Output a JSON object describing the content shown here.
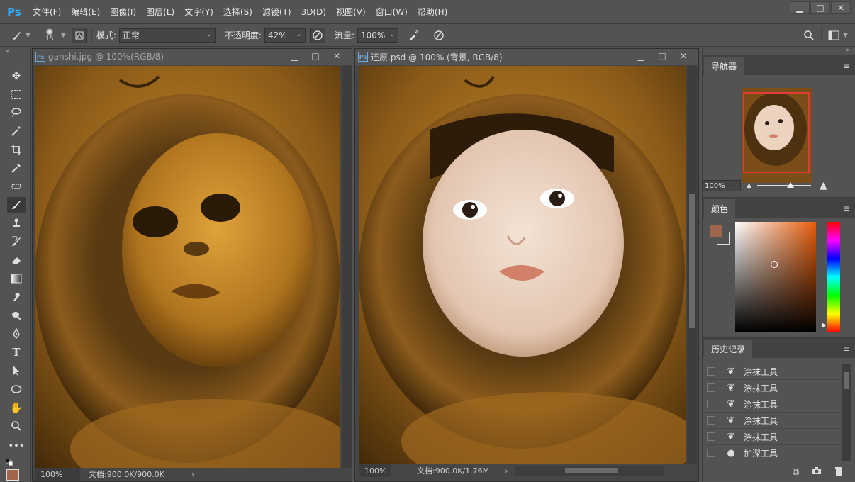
{
  "app": {
    "logo": "Ps"
  },
  "menu": [
    "文件(F)",
    "编辑(E)",
    "图像(I)",
    "图层(L)",
    "文字(Y)",
    "选择(S)",
    "滤镜(T)",
    "3D(D)",
    "视图(V)",
    "窗口(W)",
    "帮助(H)"
  ],
  "window_controls": {
    "minimize": "▁",
    "maximize": "□",
    "close": "✕"
  },
  "options": {
    "brush_size": "15",
    "mode_label": "模式:",
    "mode_value": "正常",
    "opacity_label": "不透明度:",
    "opacity_value": "42%",
    "flow_label": "流量:",
    "flow_value": "100%"
  },
  "documents": [
    {
      "title": "ganshi.jpg @ 100%(RGB/8)",
      "zoom": "100%",
      "doc_info": "文档:900.0K/900.0K"
    },
    {
      "title": "还原.psd @ 100% (背景, RGB/8)",
      "zoom": "100%",
      "doc_info": "文档:900.0K/1.76M"
    }
  ],
  "navigator": {
    "tab": "导航器",
    "zoom": "100%"
  },
  "color_panel": {
    "tab": "颜色",
    "foreground": "#a0674c"
  },
  "history": {
    "tab": "历史记录",
    "items": [
      {
        "label": "涂抹工具",
        "icon": "smudge-icon"
      },
      {
        "label": "涂抹工具",
        "icon": "smudge-icon"
      },
      {
        "label": "涂抹工具",
        "icon": "smudge-icon"
      },
      {
        "label": "涂抹工具",
        "icon": "smudge-icon"
      },
      {
        "label": "涂抹工具",
        "icon": "smudge-icon"
      },
      {
        "label": "加深工具",
        "icon": "burn-icon"
      }
    ]
  },
  "colors": {
    "accent": "#31a8ff",
    "ui_bg": "#535353",
    "panel_dark": "#424242"
  }
}
